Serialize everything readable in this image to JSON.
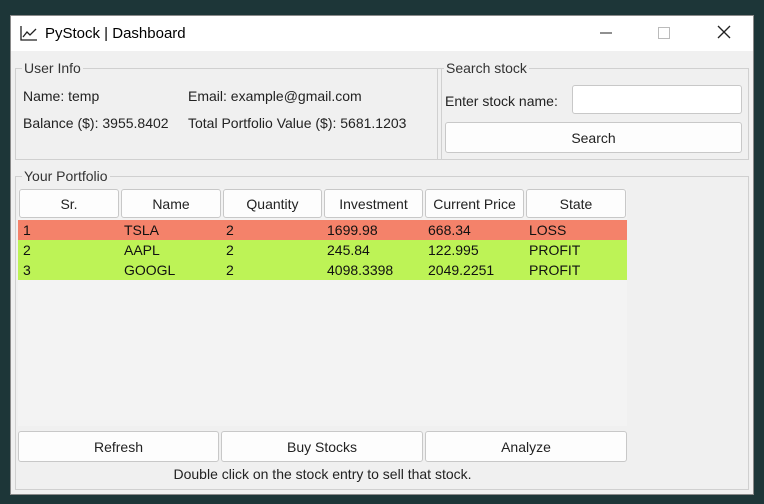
{
  "window": {
    "title": "PyStock | Dashboard"
  },
  "user_info": {
    "group_title": "User Info",
    "name": "Name: temp",
    "email": "Email: example@gmail.com",
    "balance": "Balance ($): 3955.8402",
    "portfolio_value": "Total Portfolio Value ($): 5681.1203"
  },
  "search": {
    "group_title": "Search stock",
    "label": "Enter stock name:",
    "value": "",
    "button_label": "Search"
  },
  "portfolio": {
    "group_title": "Your Portfolio",
    "columns": [
      "Sr.",
      "Name",
      "Quantity",
      "Investment",
      "Current Price",
      "State"
    ],
    "rows": [
      {
        "sr": "1",
        "name": "TSLA",
        "quantity": "2",
        "investment": "1699.98",
        "current_price": "668.34",
        "state": "LOSS",
        "color": "#f4826a"
      },
      {
        "sr": "2",
        "name": "AAPL",
        "quantity": "2",
        "investment": "245.84",
        "current_price": "122.995",
        "state": "PROFIT",
        "color": "#bdf356"
      },
      {
        "sr": "3",
        "name": "GOOGL",
        "quantity": "2",
        "investment": "4098.3398",
        "current_price": "2049.2251",
        "state": "PROFIT",
        "color": "#bdf356"
      }
    ],
    "buttons": {
      "refresh": "Refresh",
      "buy": "Buy Stocks",
      "analyze": "Analyze"
    },
    "hint": "Double click on the stock entry to sell that stock."
  },
  "icons": {
    "app": "chart-line-icon",
    "minimize": "minimize-icon",
    "maximize": "maximize-icon",
    "close": "close-icon"
  }
}
